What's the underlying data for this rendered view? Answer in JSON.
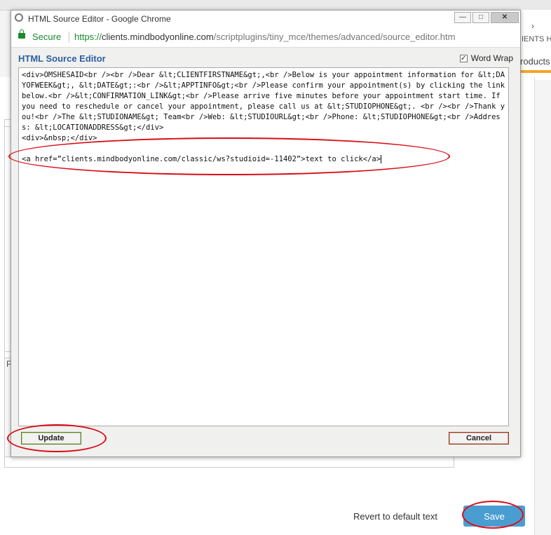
{
  "window": {
    "title": "HTML Source Editor - Google Chrome",
    "minimize": "—",
    "maximize": "□",
    "close": "✕"
  },
  "address": {
    "secure_label": "Secure",
    "url_proto": "https://",
    "url_host": "clients.mindbodyonline.com",
    "url_path": "/scriptplugins/tiny_mce/themes/advanced/source_editor.htm"
  },
  "editor": {
    "title": "HTML Source Editor",
    "word_wrap_label": "Word Wrap",
    "word_wrap_checked": true,
    "source_text": "<div>OMSHESAID<br /><br />Dear &lt;CLIENTFIRSTNAME&gt;,<br />Below is your appointment information for &lt;DAYOFWEEK&gt;, &lt;DATE&gt;:<br />&lt;APPTINFO&gt;<br />Please confirm your appointment(s) by clicking the link below.<br />&lt;CONFIRMATION_LINK&gt;<br />Please arrive five minutes before your appointment start time. If you need to reschedule or cancel your appointment, please call us at &lt;STUDIOPHONE&gt;. <br /><br />Thank you!<br />The &lt;STUDIONAME&gt; Team<br />Web: &lt;STUDIOURL&gt;<br />Phone: &lt;STUDIOPHONE&gt;<br />Address: &lt;LOCATIONADDRESS&gt;</div>\n<div>&nbsp;</div>",
    "link_line": "<a href=”clients.mindbodyonline.com/classic/ws?studioid=-11402”>text to click</a>",
    "update_label": "Update",
    "cancel_label": "Cancel"
  },
  "background": {
    "header_text": "IENTS H",
    "products_text": "roducts",
    "revert_label": "Revert to default text",
    "save_label": "Save",
    "p_label": "P"
  },
  "colors": {
    "annotation": "#d90d17",
    "save_button": "#4a9dd1",
    "editor_title": "#2b5fa3",
    "secure": "#1a8a2e"
  }
}
